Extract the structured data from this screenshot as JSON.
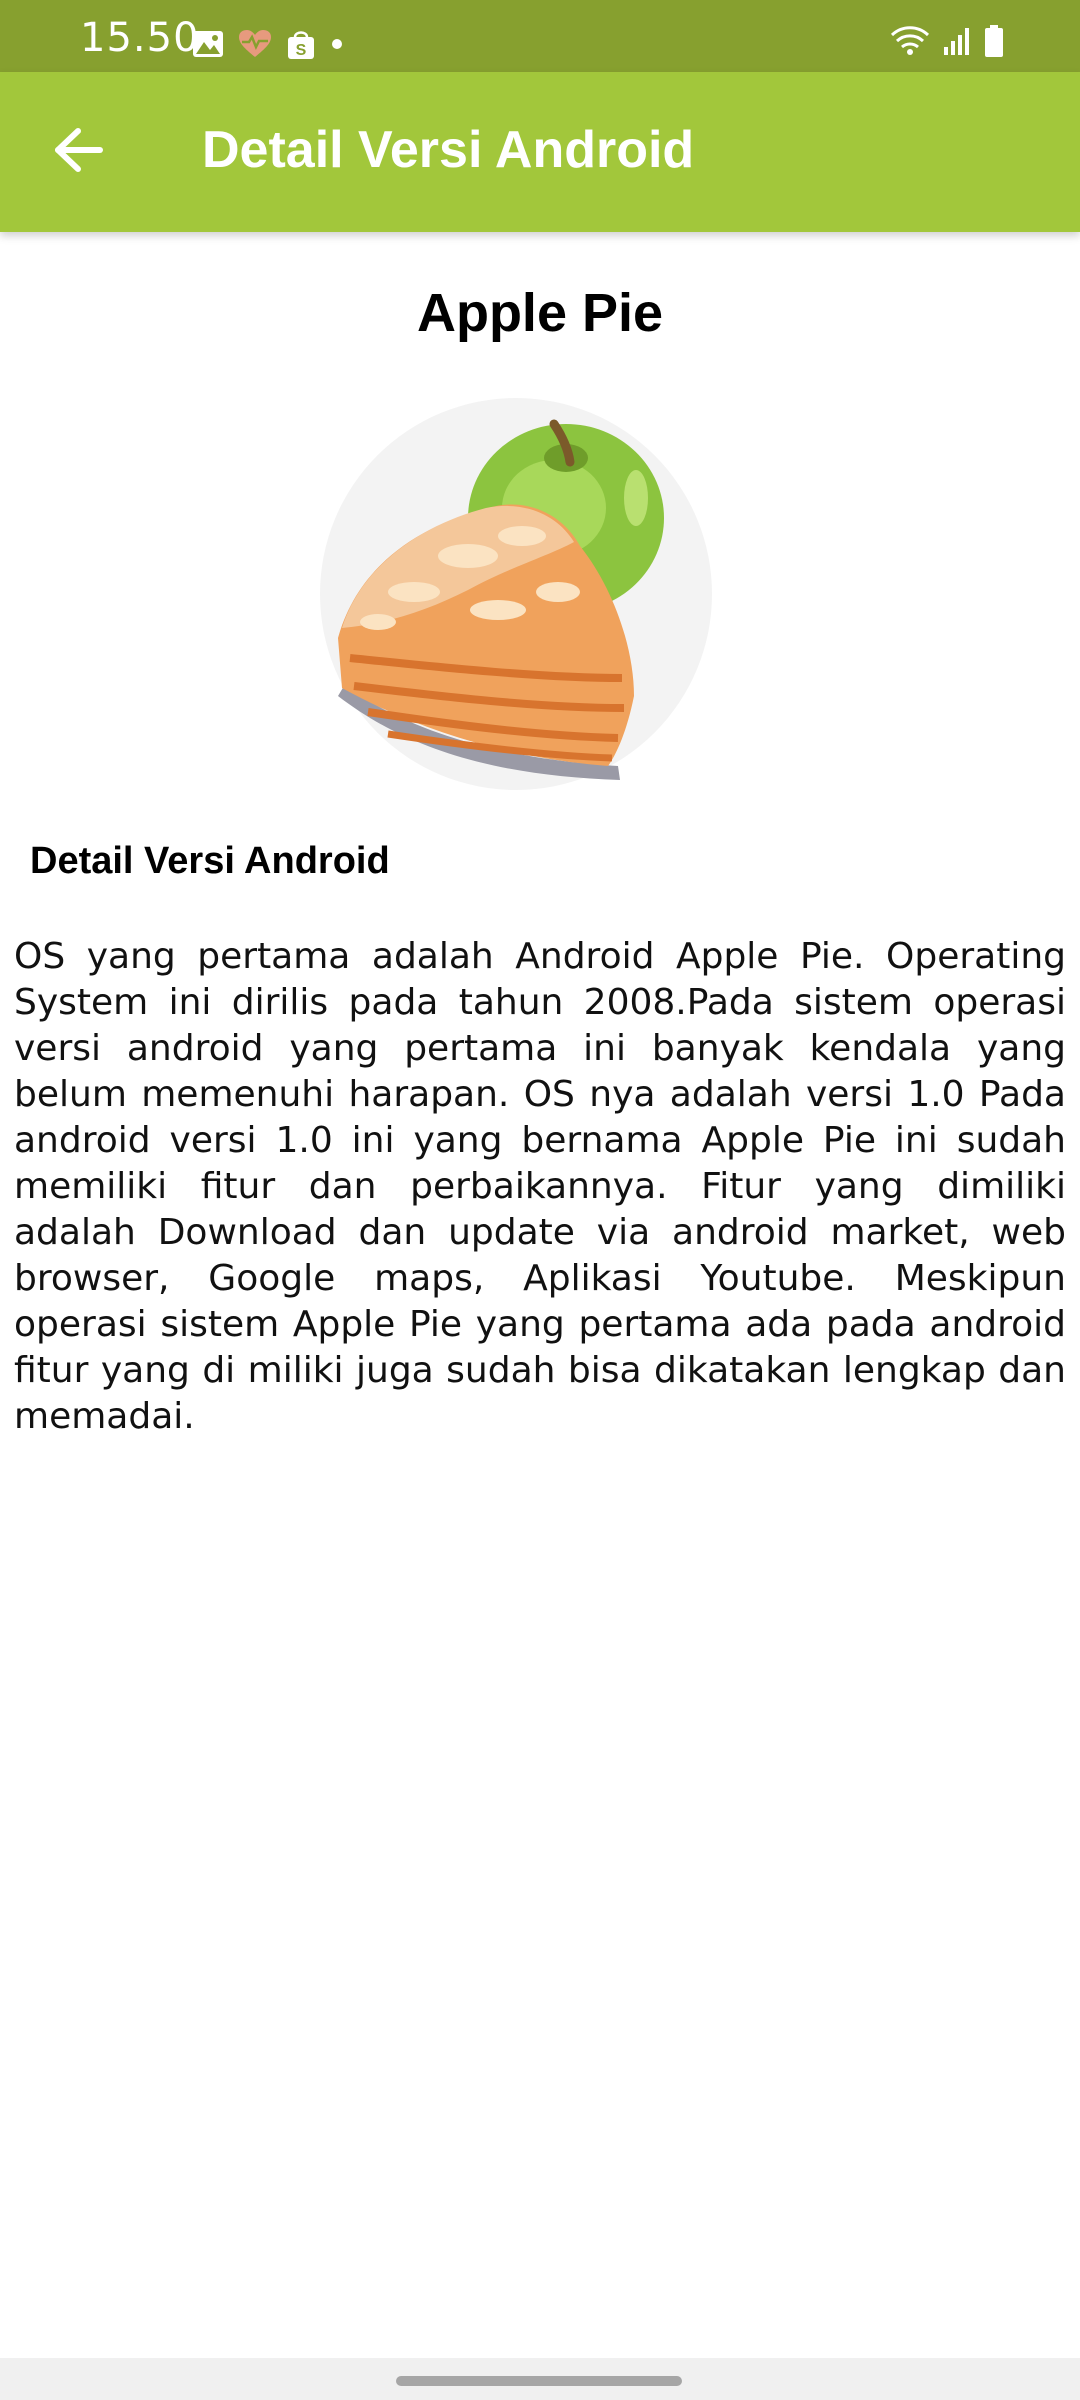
{
  "status_bar": {
    "time": "15.50",
    "left_icons": [
      "gallery-icon",
      "health-icon",
      "shop-icon",
      "dot-icon"
    ],
    "right_icons": [
      "wifi-icon",
      "signal-icon",
      "battery-icon"
    ],
    "background_color": "#87a02f"
  },
  "app_bar": {
    "title": "Detail Versi Android",
    "back_icon": "arrow-back-icon",
    "background_color": "#a2c73b"
  },
  "content": {
    "version_name": "Apple Pie",
    "image_icon": "apple-pie-image",
    "section_heading": "Detail Versi Android",
    "description": "OS yang pertama adalah Android Apple Pie. Operating System ini dirilis pada tahun 2008.Pada sistem operasi versi android yang pertama ini banyak kendala yang belum memenuhi harapan. OS nya adalah versi 1.0 Pada android versi 1.0 ini yang bernama Apple Pie ini sudah memiliki fitur dan perbaikannya. Fitur yang dimiliki adalah Download dan update via android market, web browser, Google maps, Aplikasi Youtube. Meskipun operasi sistem Apple Pie yang pertama ada pada android fitur yang di miliki juga sudah bisa dikatakan lengkap dan memadai."
  }
}
